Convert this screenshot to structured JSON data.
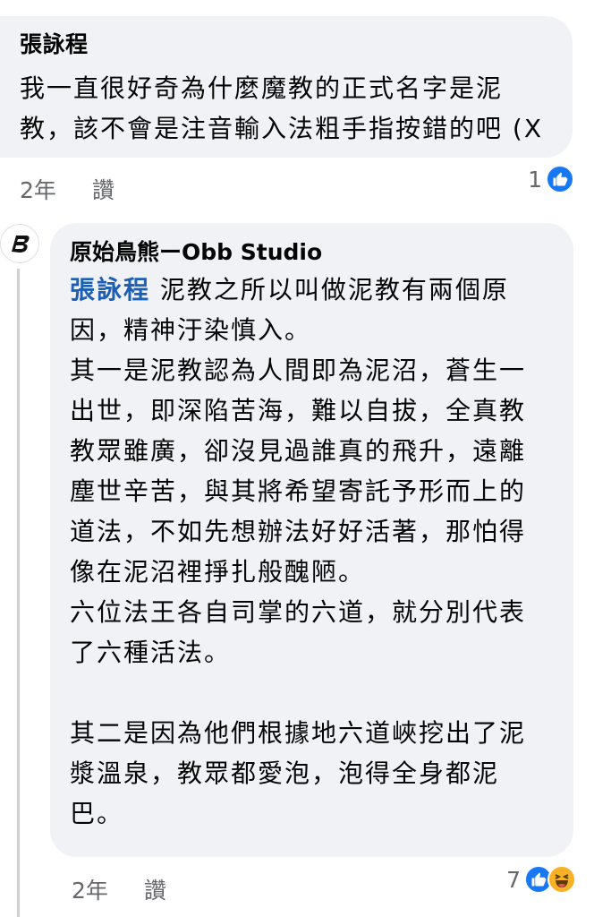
{
  "comment": {
    "author": "張詠程",
    "text": "我一直很好奇為什麼魔教的正式名字是泥\n教，該不會是注音輸入法粗手指按錯的吧 (X",
    "time": "2年",
    "like_action": "讚",
    "reaction_count": "1",
    "reactions": [
      "like-icon"
    ]
  },
  "reply": {
    "author": "原始鳥熊ーObb Studio",
    "mention": "張詠程",
    "text": " 泥教之所以叫做泥教有兩個原\n因，精神汙染慎入。\n其一是泥教認為人間即為泥沼，蒼生一\n出世，即深陷苦海，難以自拔，全真教\n教眾雖廣，卻沒見過誰真的飛升，遠離\n塵世辛苦，與其將希望寄託予形而上的\n道法，不如先想辦法好好活著，那怕得\n像在泥沼裡掙扎般醜陋。\n六位法王各自司掌的六道，就分別代表\n了六種活法。\n\n其二是因為他們根據地六道峽挖出了泥\n漿溫泉，教眾都愛泡，泡得全身都泥\n巴。",
    "time": "2年",
    "like_action": "讚",
    "reaction_count": "7",
    "reactions": [
      "like-icon",
      "haha-icon"
    ]
  },
  "colors": {
    "bubble": "#f0f2f5",
    "mention": "#1d5fb5",
    "meta": "#65676b",
    "like": "#1877f2",
    "haha": "#f7b125"
  }
}
